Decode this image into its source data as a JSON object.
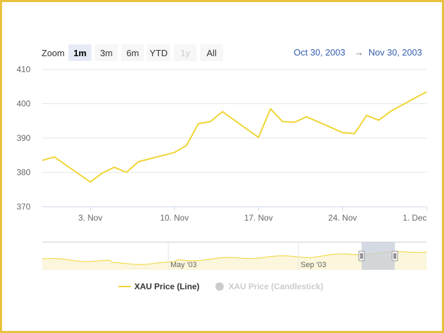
{
  "range_selector": {
    "zoom_label": "Zoom",
    "buttons": [
      {
        "label": "1m",
        "state": "active"
      },
      {
        "label": "3m",
        "state": "normal"
      },
      {
        "label": "6m",
        "state": "normal"
      },
      {
        "label": "YTD",
        "state": "normal"
      },
      {
        "label": "1y",
        "state": "disabled"
      },
      {
        "label": "All",
        "state": "normal"
      }
    ],
    "from": "Oct 30, 2003",
    "arrow": "→",
    "to": "Nov 30, 2003"
  },
  "colors": {
    "line": "#f0d432",
    "navigator_fill": "#fbf6dc",
    "navigator_mask": "#c5ccd9",
    "grid": "#e6e6e6",
    "axis_text": "#666666",
    "legend_hidden": "#cccccc"
  },
  "legend": [
    {
      "name": "XAU Price (Line)",
      "visible": true,
      "icon": "line-icon"
    },
    {
      "name": "XAU Price (Candlestick)",
      "visible": false,
      "icon": "circle-icon"
    }
  ],
  "chart_data": {
    "type": "line",
    "title": "",
    "xlabel": "",
    "ylabel": "",
    "ylim": [
      370,
      410
    ],
    "yticks": [
      370,
      380,
      390,
      400,
      410
    ],
    "xlim": [
      "2003-10-30",
      "2003-12-01"
    ],
    "xticks": [
      {
        "date": "2003-11-03",
        "label": "3. Nov"
      },
      {
        "date": "2003-11-10",
        "label": "10. Nov"
      },
      {
        "date": "2003-11-17",
        "label": "17. Nov"
      },
      {
        "date": "2003-11-24",
        "label": "24. Nov"
      },
      {
        "date": "2003-12-01",
        "label": "1. Dec"
      }
    ],
    "series": [
      {
        "name": "XAU Price (Line)",
        "x": [
          "2003-10-30",
          "2003-10-31",
          "2003-11-03",
          "2003-11-04",
          "2003-11-05",
          "2003-11-06",
          "2003-11-07",
          "2003-11-10",
          "2003-11-11",
          "2003-11-12",
          "2003-11-13",
          "2003-11-14",
          "2003-11-17",
          "2003-11-18",
          "2003-11-19",
          "2003-11-20",
          "2003-11-21",
          "2003-11-24",
          "2003-11-25",
          "2003-11-26",
          "2003-11-27",
          "2003-11-28",
          "2003-12-01"
        ],
        "y": [
          383.5,
          384.5,
          377.2,
          379.8,
          381.5,
          380.0,
          383.1,
          385.8,
          387.8,
          394.2,
          394.8,
          397.7,
          390.2,
          398.5,
          394.8,
          394.6,
          396.2,
          391.6,
          391.3,
          396.6,
          395.2,
          397.8,
          403.5
        ]
      }
    ],
    "navigator": {
      "labels": [
        {
          "date": "2003-05-01",
          "label": "May '03"
        },
        {
          "date": "2003-09-01",
          "label": "Sep '03"
        }
      ],
      "selected_from": "2003-10-30",
      "selected_to": "2003-11-30"
    }
  }
}
